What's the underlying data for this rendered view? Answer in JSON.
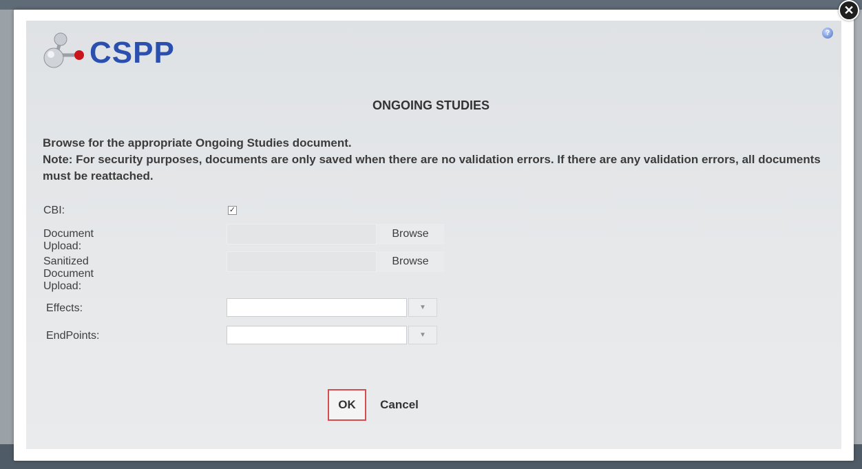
{
  "logo": {
    "text": "CSPP"
  },
  "dialog": {
    "title": "ONGOING STUDIES",
    "instruction_line1": "Browse for the appropriate Ongoing Studies document.",
    "instruction_line2": "Note: For security purposes, documents are only saved when there are no validation errors. If there are any validation errors, all documents must be reattached."
  },
  "form": {
    "cbi_label": "CBI:",
    "cbi_checked": true,
    "document_upload_label": "Document Upload:",
    "sanitized_upload_label": "Sanitized Document Upload:",
    "browse_label": "Browse",
    "effects_label": "Effects:",
    "effects_value": "",
    "endpoints_label": "EndPoints:",
    "endpoints_value": ""
  },
  "buttons": {
    "ok": "OK",
    "cancel": "Cancel"
  },
  "icons": {
    "close": "close-icon",
    "help": "help-icon",
    "dropdown": "chevron-down-icon",
    "check": "checkmark"
  },
  "colors": {
    "accent_text": "#2a4fae",
    "ok_border": "#d64b4b"
  }
}
